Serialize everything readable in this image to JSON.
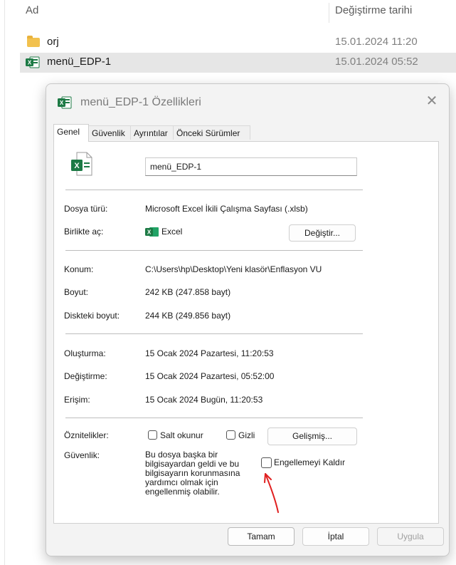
{
  "explorer": {
    "columns": {
      "name": "Ad",
      "modified": "Değiştirme tarihi"
    },
    "rows": [
      {
        "name": "orj",
        "date": "15.01.2024 11:20",
        "icon": "folder-icon"
      },
      {
        "name": "menü_EDP-1",
        "date": "15.01.2024 05:52",
        "icon": "excel-file-icon",
        "selected": true
      }
    ]
  },
  "dialog": {
    "title": "menü_EDP-1 Özellikleri",
    "close_glyph": "✕",
    "tabs": [
      "Genel",
      "Güvenlik",
      "Ayrıntılar",
      "Önceki Sürümler"
    ],
    "active_tab": "Genel",
    "file_name": "menü_EDP-1",
    "type_label": "Dosya türü:",
    "type_value": "Microsoft Excel İkili Çalışma Sayfası (.xlsb)",
    "open_with_label": "Birlikte aç:",
    "open_with_value": "Excel",
    "change_button": "Değiştir...",
    "location_label": "Konum:",
    "location_value": "C:\\Users\\hp\\Desktop\\Yeni klasör\\Enflasyon VU",
    "size_label": "Boyut:",
    "size_value": "242 KB (247.858 bayt)",
    "disk_size_label": "Diskteki boyut:",
    "disk_size_value": "244 KB (249.856 bayt)",
    "created_label": "Oluşturma:",
    "created_value": "15 Ocak 2024 Pazartesi, 11:20:53",
    "modified_label": "Değiştirme:",
    "modified_value": "15 Ocak 2024 Pazartesi, 05:52:00",
    "accessed_label": "Erişim:",
    "accessed_value": "15 Ocak 2024 Bugün, 11:20:53",
    "attributes_label": "Öznitelikler:",
    "readonly_label": "Salt okunur",
    "hidden_label": "Gizli",
    "advanced_button": "Gelişmiş...",
    "security_label": "Güvenlik:",
    "security_lines": [
      "Bu dosya başka bir",
      "bilgisayardan geldi ve bu",
      "bilgisayarın korunmasına",
      "yardımcı olmak için",
      "engellenmiş olabilir."
    ],
    "unblock_label": "Engellemeyi Kaldır",
    "ok_button": "Tamam",
    "cancel_button": "İptal",
    "apply_button": "Uygula"
  },
  "colors": {
    "excel_green": "#1d7a45",
    "arrow_red": "#e02020"
  }
}
